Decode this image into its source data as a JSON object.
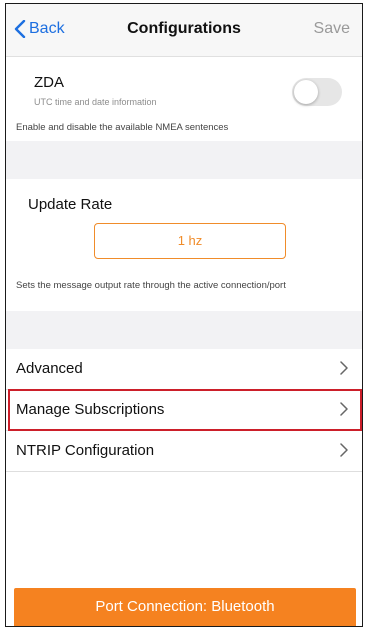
{
  "header": {
    "back_label": "Back",
    "title": "Configurations",
    "save_label": "Save"
  },
  "zda": {
    "title": "ZDA",
    "subtitle": "UTC time and date information",
    "enabled": false
  },
  "nmea_help": "Enable and disable the available NMEA sentences",
  "update_rate": {
    "title": "Update Rate",
    "value": "1 hz",
    "help": "Sets the message output rate through the active connection/port"
  },
  "list": {
    "items": [
      {
        "label": "Advanced"
      },
      {
        "label": "Manage Subscriptions"
      },
      {
        "label": "NTRIP Configuration"
      }
    ]
  },
  "footer": {
    "port_button": "Port Connection: Bluetooth"
  },
  "colors": {
    "accent": "#f58220",
    "link": "#1d6fe0",
    "highlight": "#cc1f2a"
  }
}
